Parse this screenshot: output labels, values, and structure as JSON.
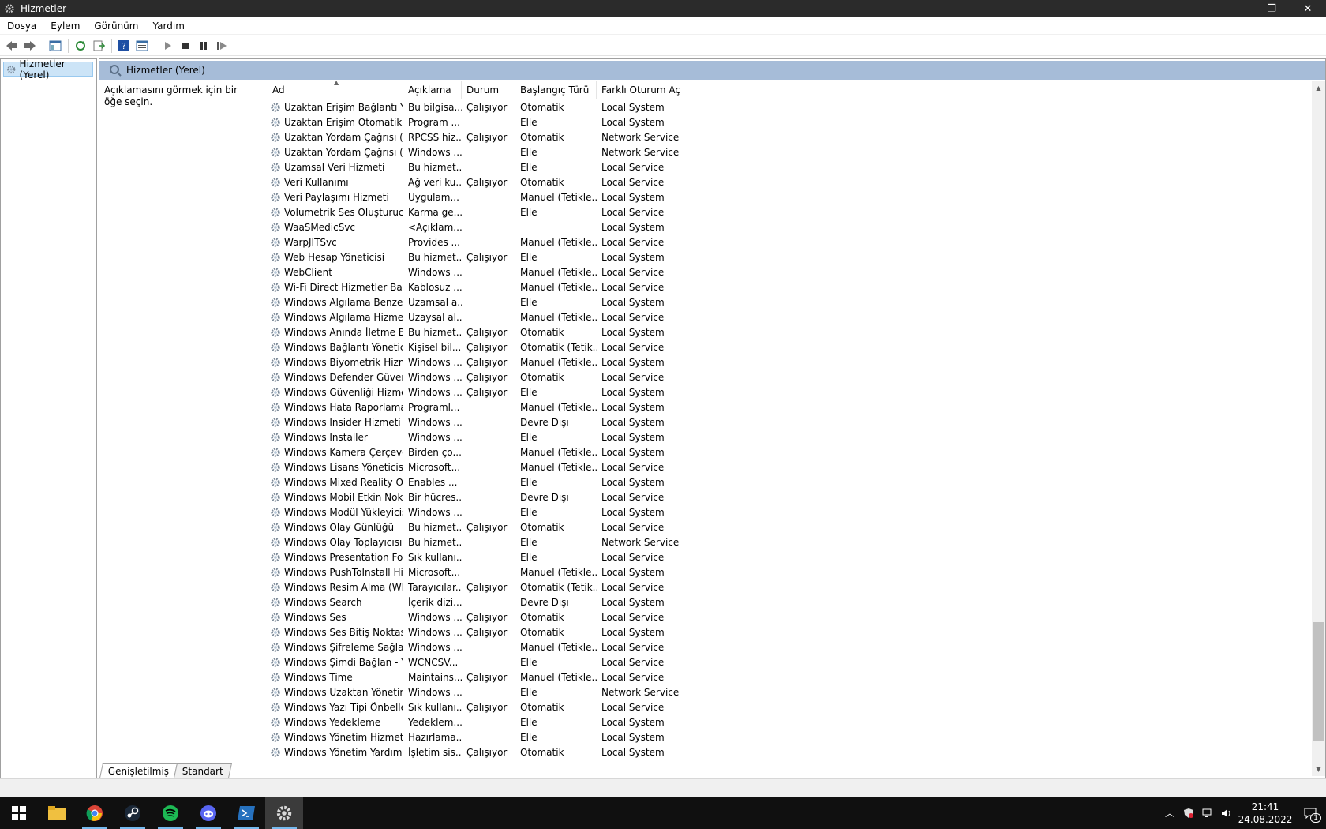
{
  "window": {
    "title": "Hizmetler",
    "minimize": "—",
    "restore": "❐",
    "close": "✕"
  },
  "menu": [
    "Dosya",
    "Eylem",
    "Görünüm",
    "Yardım"
  ],
  "tree": {
    "root_label": "Hizmetler (Yerel)"
  },
  "pane": {
    "header_title": "Hizmetler (Yerel)",
    "description_hint": "Açıklamasını görmek için bir öğe seçin.",
    "columns": [
      "Ad",
      "Açıklama",
      "Durum",
      "Başlangıç Türü",
      "Farklı Oturum Aç"
    ],
    "sorted_column": "Ad",
    "rows": [
      [
        "Uzaktan Erişim Bağlantı Yön...",
        "Bu bilgisa...",
        "Çalışıyor",
        "Otomatik",
        "Local System"
      ],
      [
        "Uzaktan Erişim Otomatik Ba...",
        "Program ...",
        "",
        "Elle",
        "Local System"
      ],
      [
        "Uzaktan Yordam Çağrısı (RP...",
        "RPCSS hiz...",
        "Çalışıyor",
        "Otomatik",
        "Network Service"
      ],
      [
        "Uzaktan Yordam Çağrısı (RP...",
        "Windows ...",
        "",
        "Elle",
        "Network Service"
      ],
      [
        "Uzamsal Veri Hizmeti",
        "Bu hizmet...",
        "",
        "Elle",
        "Local Service"
      ],
      [
        "Veri Kullanımı",
        "Ağ veri ku...",
        "Çalışıyor",
        "Otomatik",
        "Local Service"
      ],
      [
        "Veri Paylaşımı Hizmeti",
        "Uygulam...",
        "",
        "Manuel (Tetikle...",
        "Local System"
      ],
      [
        "Volumetrik Ses Oluşturucu ...",
        "Karma ge...",
        "",
        "Elle",
        "Local Service"
      ],
      [
        "WaaSMedicSvc",
        "<Açıklam...",
        "",
        "",
        "Local System"
      ],
      [
        "WarpJITSvc",
        "Provides ...",
        "",
        "Manuel (Tetikle...",
        "Local Service"
      ],
      [
        "Web Hesap Yöneticisi",
        "Bu hizmet...",
        "Çalışıyor",
        "Elle",
        "Local System"
      ],
      [
        "WebClient",
        "Windows ...",
        "",
        "Manuel (Tetikle...",
        "Local Service"
      ],
      [
        "Wi-Fi Direct Hizmetler Bağl...",
        "Kablosuz ...",
        "",
        "Manuel (Tetikle...",
        "Local Service"
      ],
      [
        "Windows Algılama Benzeti...",
        "Uzamsal a...",
        "",
        "Elle",
        "Local System"
      ],
      [
        "Windows Algılama Hizmeti",
        "Uzaysal al...",
        "",
        "Manuel (Tetikle...",
        "Local Service"
      ],
      [
        "Windows Anında İletme Bil...",
        "Bu hizmet...",
        "Çalışıyor",
        "Otomatik",
        "Local System"
      ],
      [
        "Windows Bağlantı Yöneticisi",
        "Kişisel bil...",
        "Çalışıyor",
        "Otomatik (Tetik...",
        "Local Service"
      ],
      [
        "Windows Biyometrik Hizmeti",
        "Windows ...",
        "Çalışıyor",
        "Manuel (Tetikle...",
        "Local System"
      ],
      [
        "Windows Defender Güvenli...",
        "Windows ...",
        "Çalışıyor",
        "Otomatik",
        "Local Service"
      ],
      [
        "Windows Güvenliği Hizmeti",
        "Windows ...",
        "Çalışıyor",
        "Elle",
        "Local System"
      ],
      [
        "Windows Hata Raporlama ...",
        "Programl...",
        "",
        "Manuel (Tetikle...",
        "Local System"
      ],
      [
        "Windows Insider Hizmeti",
        "Windows ...",
        "",
        "Devre Dışı",
        "Local System"
      ],
      [
        "Windows Installer",
        "Windows ...",
        "",
        "Elle",
        "Local System"
      ],
      [
        "Windows Kamera Çerçeve S...",
        "Birden ço...",
        "",
        "Manuel (Tetikle...",
        "Local System"
      ],
      [
        "Windows Lisans Yöneticisi ...",
        "Microsoft...",
        "",
        "Manuel (Tetikle...",
        "Local Service"
      ],
      [
        "Windows Mixed Reality Op...",
        "Enables ...",
        "",
        "Elle",
        "Local System"
      ],
      [
        "Windows Mobil Etkin Nokta...",
        "Bir hücres...",
        "",
        "Devre Dışı",
        "Local Service"
      ],
      [
        "Windows Modül Yükleyicisi",
        "Windows ...",
        "",
        "Elle",
        "Local System"
      ],
      [
        "Windows Olay Günlüğü",
        "Bu hizmet...",
        "Çalışıyor",
        "Otomatik",
        "Local Service"
      ],
      [
        "Windows Olay Toplayıcısı",
        "Bu hizmet...",
        "",
        "Elle",
        "Network Service"
      ],
      [
        "Windows Presentation Fou...",
        "Sık kullanı...",
        "",
        "Elle",
        "Local Service"
      ],
      [
        "Windows PushToInstall Hiz...",
        "Microsoft...",
        "",
        "Manuel (Tetikle...",
        "Local System"
      ],
      [
        "Windows Resim Alma (WIA)",
        "Tarayıcılar...",
        "Çalışıyor",
        "Otomatik (Tetik...",
        "Local Service"
      ],
      [
        "Windows Search",
        "İçerik dizi...",
        "",
        "Devre Dışı",
        "Local System"
      ],
      [
        "Windows Ses",
        "Windows ...",
        "Çalışıyor",
        "Otomatik",
        "Local Service"
      ],
      [
        "Windows Ses Bitiş Noktası ...",
        "Windows ...",
        "Çalışıyor",
        "Otomatik",
        "Local System"
      ],
      [
        "Windows Şifreleme Sağlayıc...",
        "Windows ...",
        "",
        "Manuel (Tetikle...",
        "Local Service"
      ],
      [
        "Windows Şimdi Bağlan - Ya...",
        "WCNCSV...",
        "",
        "Elle",
        "Local Service"
      ],
      [
        "Windows Time",
        "Maintains...",
        "Çalışıyor",
        "Manuel (Tetikle...",
        "Local Service"
      ],
      [
        "Windows Uzaktan Yönetim ...",
        "Windows ...",
        "",
        "Elle",
        "Network Service"
      ],
      [
        "Windows Yazı Tipi Önbelleğ...",
        "Sık kullanı...",
        "Çalışıyor",
        "Otomatik",
        "Local Service"
      ],
      [
        "Windows Yedekleme",
        "Yedeklem...",
        "",
        "Elle",
        "Local System"
      ],
      [
        "Windows Yönetim Hizmeti",
        "Hazırlama...",
        "",
        "Elle",
        "Local System"
      ],
      [
        "Windows Yönetim Yardımcı...",
        "İşletim sis...",
        "Çalışıyor",
        "Otomatik",
        "Local System"
      ]
    ]
  },
  "tabs": [
    "Genişletilmiş",
    "Standart"
  ],
  "active_tab": "Genişletilmiş",
  "taskbar": {
    "apps": [
      "start-icon",
      "file-explorer-icon",
      "chrome-icon",
      "steam-icon",
      "spotify-icon",
      "discord-icon",
      "powershell-icon",
      "services-icon"
    ],
    "time": "21:41",
    "date": "24.08.2022",
    "notification_count": "1"
  },
  "colors": {
    "titlebar": "#2b2b2b",
    "pane_header": "#a6bcd8",
    "taskbar": "#101010",
    "selection": "#cce4f7"
  }
}
